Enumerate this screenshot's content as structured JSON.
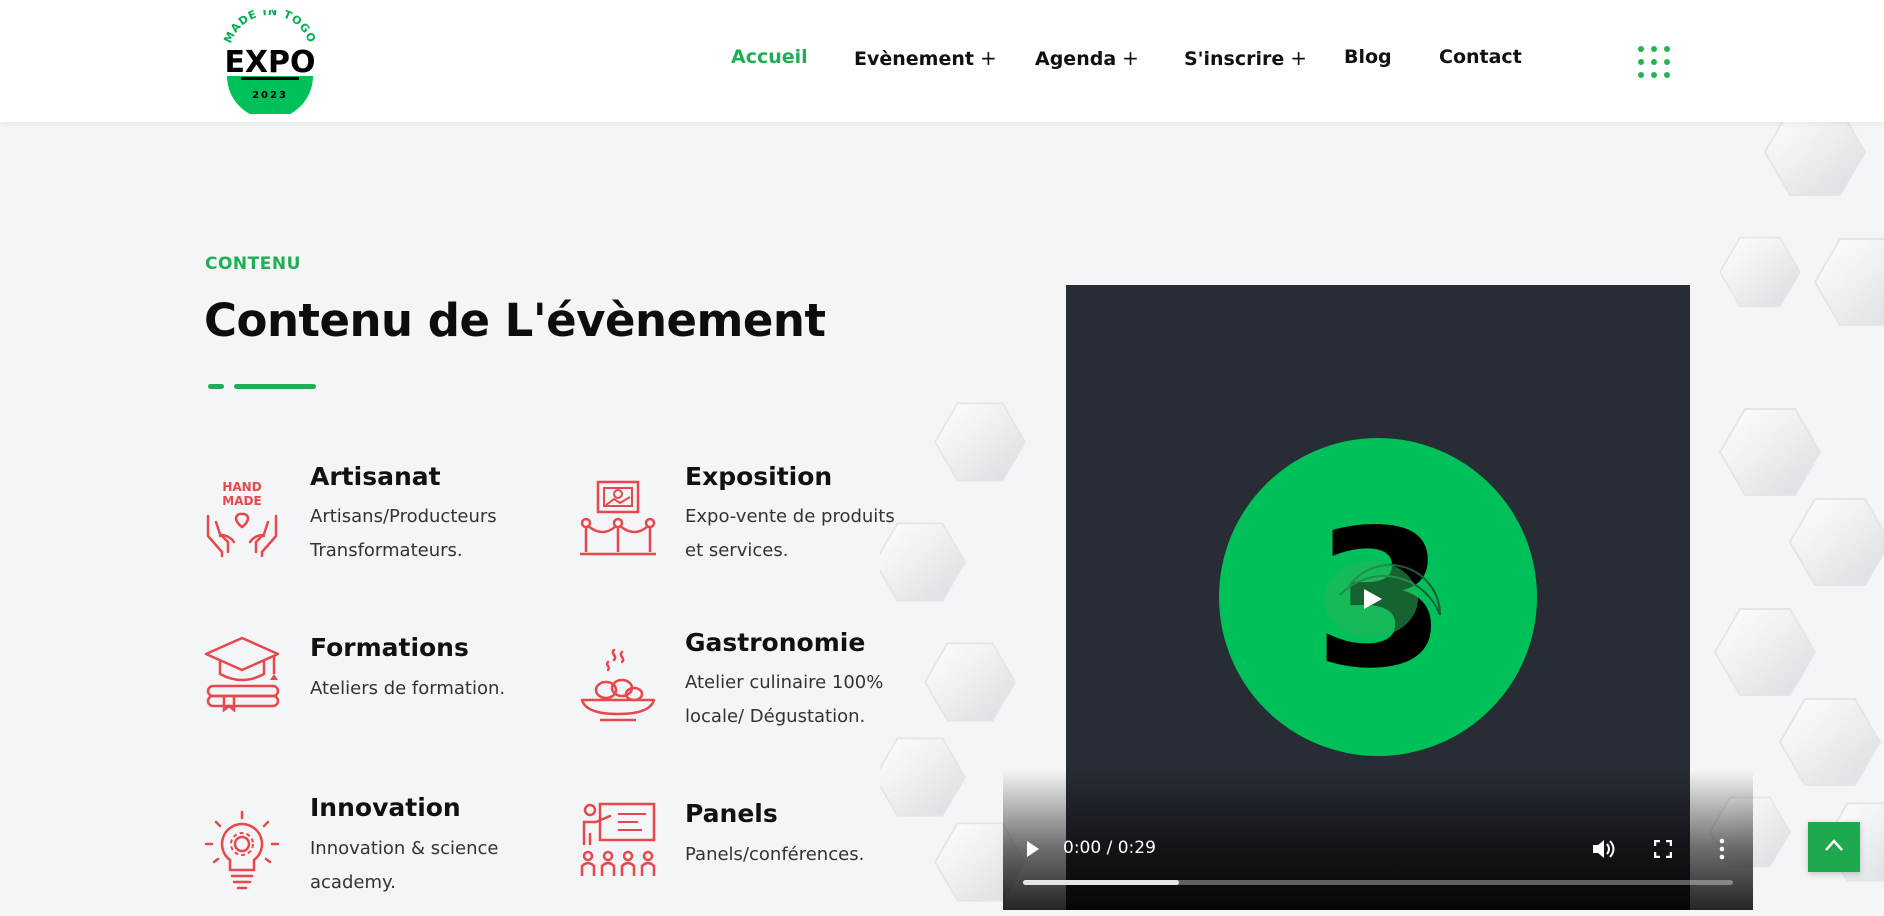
{
  "header": {
    "logo": {
      "top_text": "MADE IN TOGO",
      "main_text": "EXPO",
      "year": "2023"
    },
    "nav": [
      {
        "label": "Accueil",
        "has_plus": false,
        "active": true
      },
      {
        "label": "Evènement",
        "has_plus": true,
        "active": false
      },
      {
        "label": "Agenda",
        "has_plus": true,
        "active": false
      },
      {
        "label": "S'inscrire",
        "has_plus": true,
        "active": false
      },
      {
        "label": "Blog",
        "has_plus": false,
        "active": false
      },
      {
        "label": "Contact",
        "has_plus": false,
        "active": false
      }
    ],
    "plus_symbol": "+",
    "menu_icon": "grid-dots-icon"
  },
  "section": {
    "eyebrow": "CONTENU",
    "title": "Contenu de L'évènement",
    "features": [
      {
        "icon": "handmade-hands-icon",
        "title": "Artisanat",
        "desc": [
          "Artisans/Producteurs",
          "Transformateurs."
        ]
      },
      {
        "icon": "exhibition-frame-icon",
        "title": "Exposition",
        "desc": [
          "Expo-vente de produits",
          "et services."
        ]
      },
      {
        "icon": "graduation-cap-icon",
        "title": "Formations",
        "desc": [
          "Ateliers de formation."
        ]
      },
      {
        "icon": "food-plate-icon",
        "title": "Gastronomie",
        "desc": [
          "Atelier culinaire 100%",
          "locale/ Dégustation."
        ]
      },
      {
        "icon": "lightbulb-gear-icon",
        "title": "Innovation",
        "desc": [
          "Innovation & science",
          "academy."
        ]
      },
      {
        "icon": "presentation-audience-icon",
        "title": "Panels",
        "desc": [
          "Panels/conférences."
        ]
      }
    ]
  },
  "video": {
    "time": "0:00 / 0:29",
    "progress": 0.22,
    "poster_glyph": "3"
  },
  "colors": {
    "accent": "#1fae55",
    "icon_red": "#e8474c",
    "video_bg": "#282d35",
    "video_circle": "#00c05a"
  }
}
